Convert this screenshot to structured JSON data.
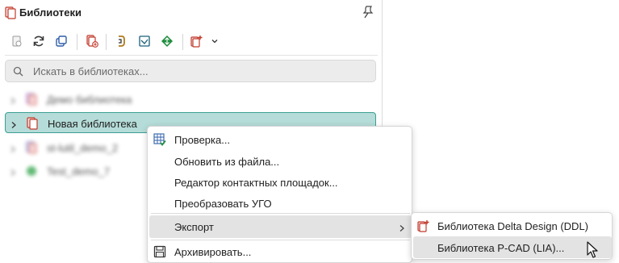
{
  "panel": {
    "title": "Библиотеки"
  },
  "search": {
    "placeholder": "Искать в библиотеках..."
  },
  "tree": {
    "items": [
      {
        "label": "Демо библиотека",
        "blurred": true
      },
      {
        "label": "Новая библиотека",
        "selected": true
      },
      {
        "label": "st-lutil_demo_2",
        "blurred": true
      },
      {
        "label": "Test_demo_7",
        "blurred": true
      }
    ]
  },
  "context_menu": {
    "items": [
      {
        "label": "Проверка...",
        "icon": "check-table-icon"
      },
      {
        "label": "Обновить из файла...",
        "icon": ""
      },
      {
        "label": "Редактор контактных площадок...",
        "icon": ""
      },
      {
        "label": "Преобразовать УГО",
        "icon": ""
      },
      {
        "label": "Экспорт",
        "icon": "",
        "has_submenu": true,
        "highlighted": true
      },
      {
        "label": "Архивировать...",
        "icon": "archive-icon"
      }
    ]
  },
  "export_submenu": {
    "items": [
      {
        "label": "Библиотека Delta Design (DDL)",
        "icon": "library-export-icon"
      },
      {
        "label": "Библиотека P-CAD (LIA)...",
        "icon": "",
        "highlighted": true
      }
    ]
  },
  "colors": {
    "accent_teal": "#3c9f93",
    "selection_bg": "#b5dcd8",
    "icon_red": "#c0392b",
    "icon_green": "#1e8e3e"
  }
}
